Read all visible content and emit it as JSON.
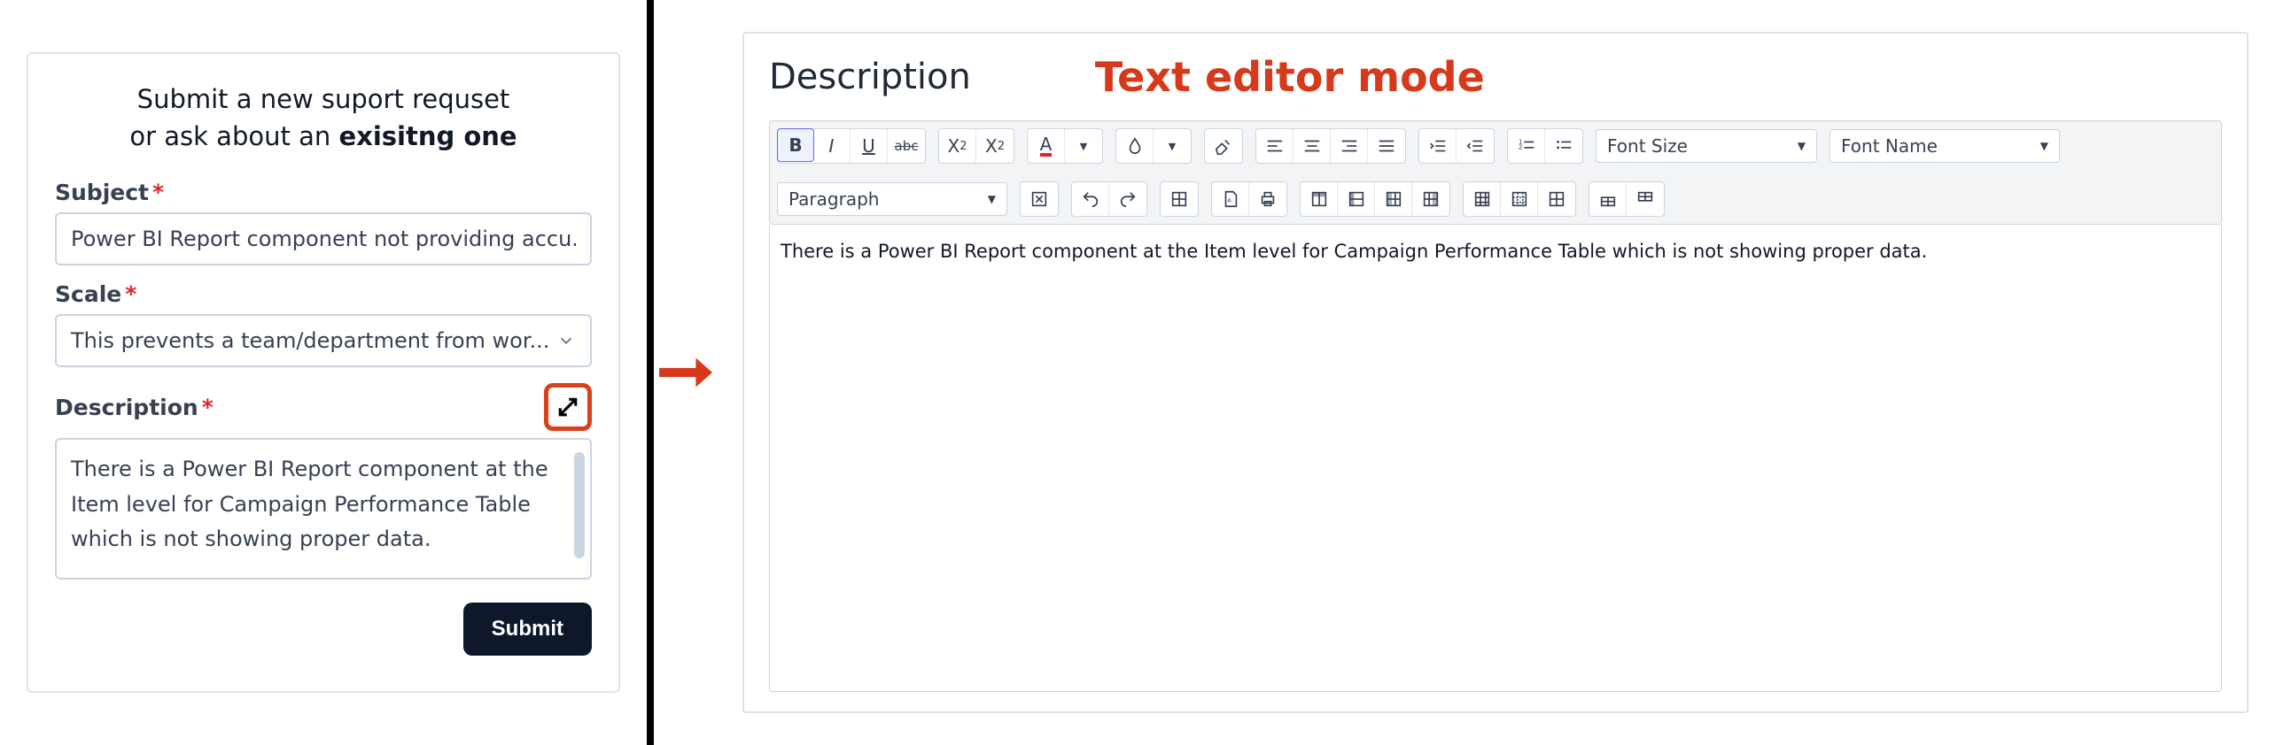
{
  "form": {
    "heading_line1": "Submit a new suport requset",
    "heading_line2_a": "or ask about an ",
    "heading_line2_b": "exisitng one",
    "subject_label": "Subject",
    "subject_value": "Power BI Report component not providing accu...",
    "scale_label": "Scale",
    "scale_value": "This prevents a team/department from wor...",
    "description_label": "Description",
    "description_value": "There is a Power BI Report component at the Item level for Campaign Performance Table which is not showing proper data.",
    "submit_label": "Submit",
    "required_mark": "*"
  },
  "editor": {
    "title": "Description",
    "badge": "Text editor mode",
    "paragraph_select": "Paragraph",
    "font_size_select": "Font Size",
    "font_name_select": "Font Name",
    "body_text": "There is a Power BI Report component at the Item level for Campaign Performance Table which is not showing proper data."
  },
  "toolbar": {
    "bold": "B",
    "italic": "I",
    "underline": "U",
    "strike": "abc",
    "subscript_x": "X",
    "subscript_n": "2",
    "superscript_x": "X",
    "superscript_n": "2",
    "fontcolor_a": "A",
    "dropdown_tri": "▼"
  }
}
